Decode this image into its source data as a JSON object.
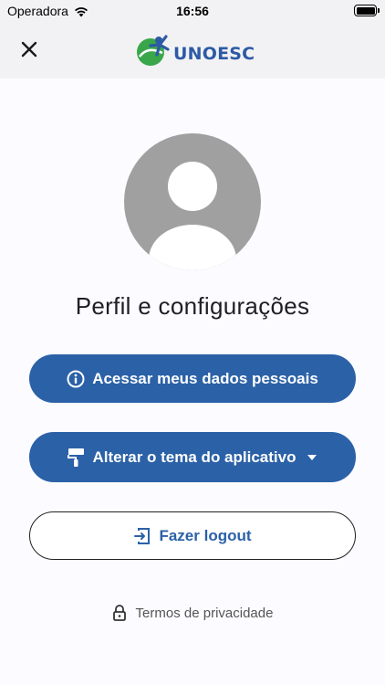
{
  "status_bar": {
    "carrier": "Operadora",
    "time": "16:56"
  },
  "header": {
    "brand": "UNOESC",
    "close_icon": "close-icon"
  },
  "profile": {
    "title": "Perfil e configurações"
  },
  "actions": {
    "personal_data": "Acessar meus dados pessoais",
    "theme": "Alterar o tema do aplicativo",
    "logout": "Fazer logout"
  },
  "footer": {
    "privacy": "Termos de privacidade"
  },
  "colors": {
    "primary": "#2b61a7",
    "avatar": "#a0a0a0",
    "logo_green": "#3aa64a"
  }
}
